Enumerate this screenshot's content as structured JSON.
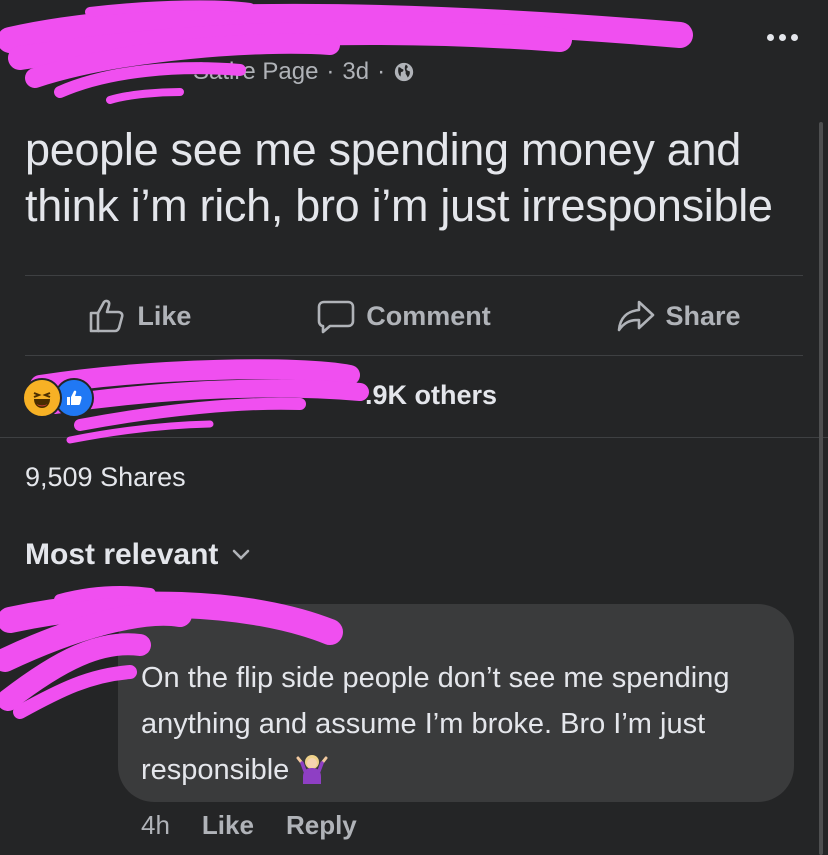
{
  "post": {
    "author_label": "Satire Page",
    "time": "3d",
    "text": "people see me spending money and think i’m rich, bro i’m just irresponsible"
  },
  "actions": {
    "like": "Like",
    "comment": "Comment",
    "share": "Share"
  },
  "reactions": {
    "others_text": ".9K others"
  },
  "shares": "9,509 Shares",
  "sort_label": "Most relevant",
  "comment": {
    "text": "On the flip side people don’t see me spending anything and assume I’m broke. Bro I’m just responsible",
    "time": "4h",
    "like": "Like",
    "reply": "Reply"
  },
  "icons": {
    "more": "more-dots-icon",
    "globe": "globe-icon",
    "like": "thumbs-up-icon",
    "comment": "speech-bubble-icon",
    "share": "share-arrow-icon",
    "haha": "laughing-emoji-icon",
    "like_reaction": "like-reaction-icon",
    "chevron": "chevron-down-icon",
    "shrug": "person-shrugging-emoji-icon"
  },
  "colors": {
    "background": "#242526",
    "bubble": "#3a3b3c",
    "text": "#e4e6eb",
    "muted": "#b0b3b8",
    "redaction": "#f04ff0",
    "haha": "#f7b125",
    "like_blue": "#2078f4"
  }
}
